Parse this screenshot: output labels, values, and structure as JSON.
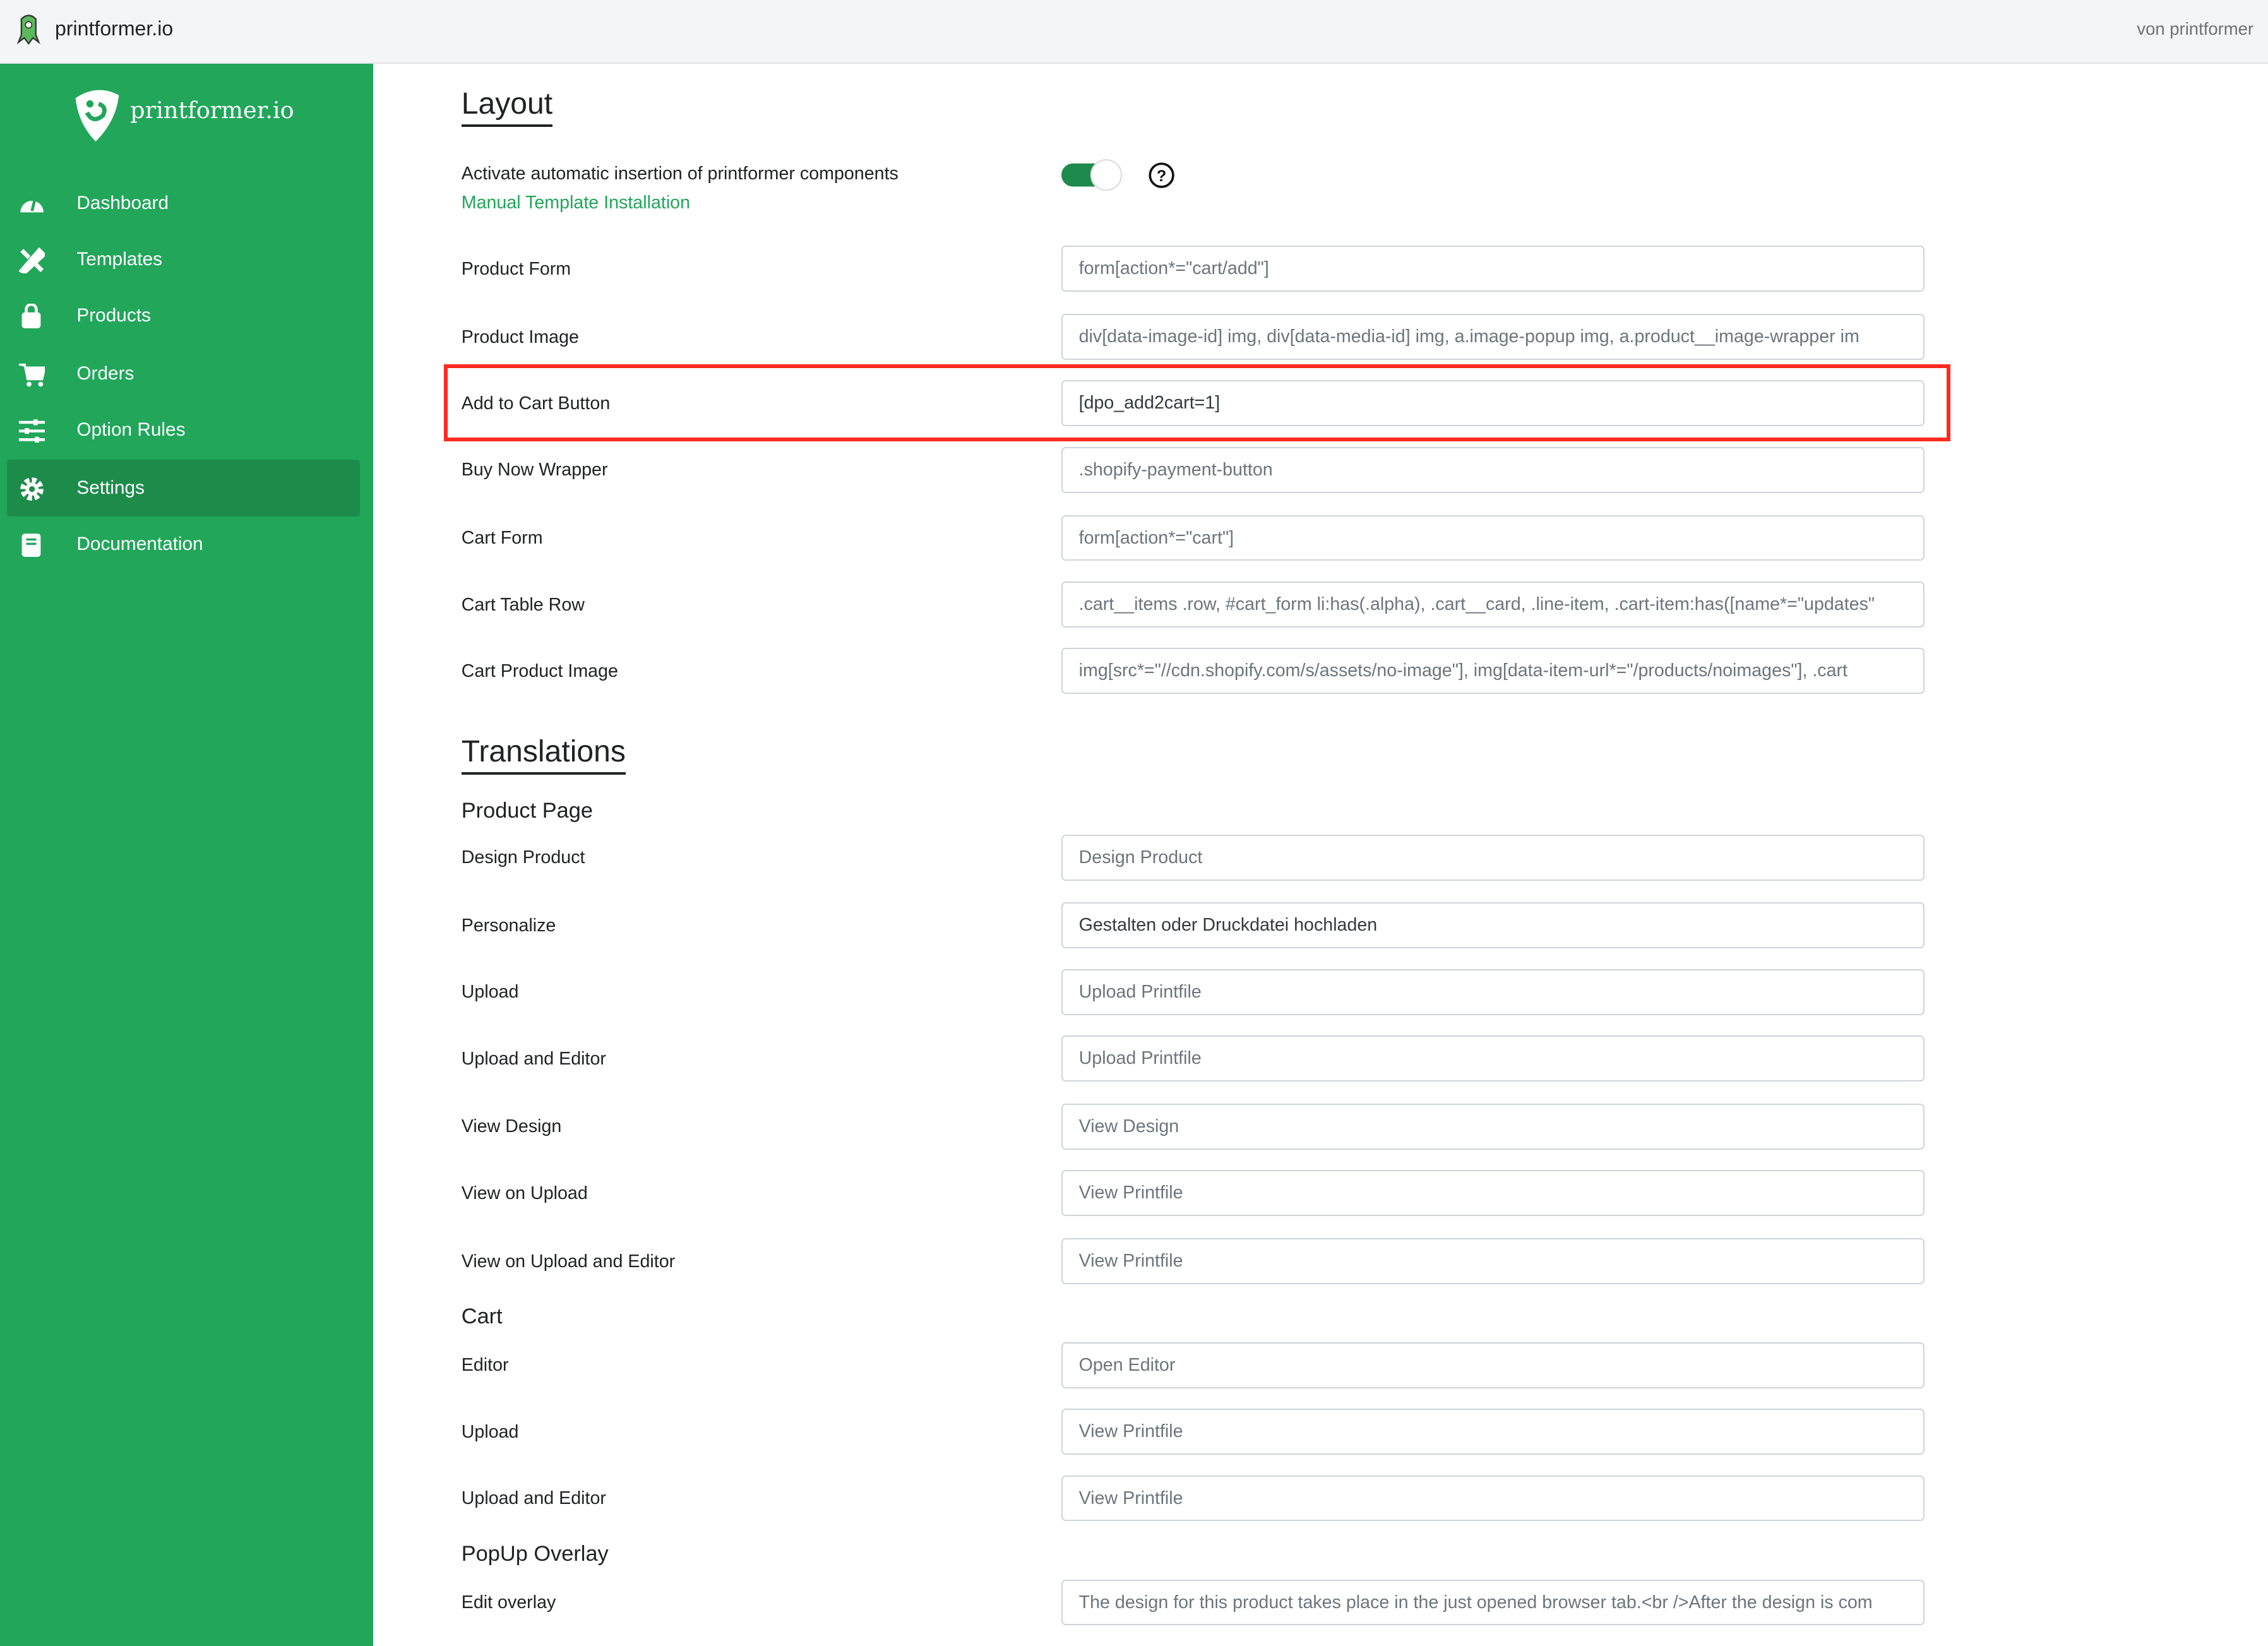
{
  "topbar": {
    "app_name": "printformer.io",
    "by_text": "von printformer"
  },
  "sidebar": {
    "logo_text": "printformer.io",
    "items": [
      {
        "label": "Dashboard",
        "icon": "dashboard-icon"
      },
      {
        "label": "Templates",
        "icon": "templates-icon"
      },
      {
        "label": "Products",
        "icon": "shopping-bag-icon"
      },
      {
        "label": "Orders",
        "icon": "cart-icon"
      },
      {
        "label": "Option Rules",
        "icon": "sliders-icon"
      },
      {
        "label": "Settings",
        "icon": "gear-icon",
        "active": true
      },
      {
        "label": "Documentation",
        "icon": "book-icon"
      }
    ]
  },
  "layout": {
    "title": "Layout",
    "auto_insert_label": "Activate automatic insertion of printformer components",
    "auto_insert_enabled": true,
    "manual_link": "Manual Template Installation",
    "fields": [
      {
        "label": "Product Form",
        "placeholder": "form[action*=\"cart/add\"]",
        "value": ""
      },
      {
        "label": "Product Image",
        "placeholder": "div[data-image-id] img, div[data-media-id] img, a.image-popup img, a.product__image-wrapper im",
        "value": ""
      },
      {
        "label": "Add to Cart Button",
        "placeholder": "",
        "value": "[dpo_add2cart=1]"
      },
      {
        "label": "Buy Now Wrapper",
        "placeholder": ".shopify-payment-button",
        "value": ""
      },
      {
        "label": "Cart Form",
        "placeholder": "form[action*=\"cart\"]",
        "value": ""
      },
      {
        "label": "Cart Table Row",
        "placeholder": ".cart__items .row, #cart_form li:has(.alpha), .cart__card, .line-item, .cart-item:has([name*=\"updates\"",
        "value": ""
      },
      {
        "label": "Cart Product Image",
        "placeholder": "img[src*=\"//cdn.shopify.com/s/assets/no-image\"], img[data-item-url*=\"/products/noimages\"], .cart",
        "value": ""
      }
    ]
  },
  "translations": {
    "title": "Translations",
    "product_page": {
      "title": "Product Page",
      "fields": [
        {
          "label": "Design Product",
          "placeholder": "Design Product",
          "value": ""
        },
        {
          "label": "Personalize",
          "placeholder": "",
          "value": "Gestalten oder Druckdatei hochladen"
        },
        {
          "label": "Upload",
          "placeholder": "Upload Printfile",
          "value": ""
        },
        {
          "label": "Upload and Editor",
          "placeholder": "Upload Printfile",
          "value": ""
        },
        {
          "label": "View Design",
          "placeholder": "View Design",
          "value": ""
        },
        {
          "label": "View on Upload",
          "placeholder": "View Printfile",
          "value": ""
        },
        {
          "label": "View on Upload and Editor",
          "placeholder": "View Printfile",
          "value": ""
        }
      ]
    },
    "cart": {
      "title": "Cart",
      "fields": [
        {
          "label": "Editor",
          "placeholder": "Open Editor",
          "value": ""
        },
        {
          "label": "Upload",
          "placeholder": "View Printfile",
          "value": ""
        },
        {
          "label": "Upload and Editor",
          "placeholder": "View Printfile",
          "value": ""
        }
      ]
    },
    "popup": {
      "title": "PopUp Overlay",
      "fields": [
        {
          "label": "Edit overlay",
          "placeholder": "The design for this product takes place in the just opened browser tab.<br />After the design is com",
          "value": ""
        }
      ]
    }
  },
  "colors": {
    "brand": "#21a65a",
    "active_nav": "#1d8c4b",
    "highlight": "#ff2a1f"
  }
}
